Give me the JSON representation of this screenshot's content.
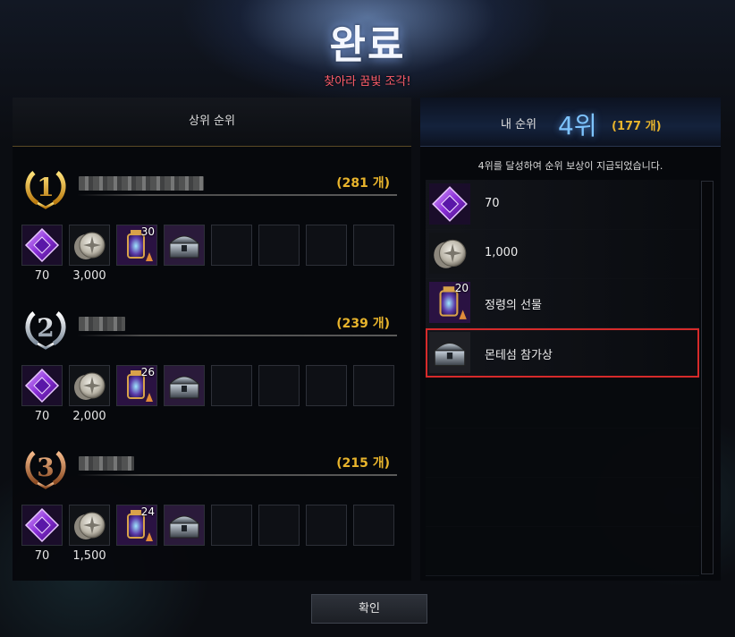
{
  "header": {
    "title": "완료",
    "subtitle": "찾아라 꿈빛 조각!"
  },
  "leaderboard": {
    "title": "상위 순위",
    "ranks": [
      {
        "rank": "1",
        "medal": "gold-laurel-medal",
        "score": "(281 개)",
        "rewards": [
          {
            "icon": "purple-crystal-icon",
            "value": "70",
            "badge": ""
          },
          {
            "icon": "silver-coin-icon",
            "value": "3,000",
            "badge": ""
          },
          {
            "icon": "lantern-gift-icon",
            "value": "",
            "badge": "30"
          },
          {
            "icon": "treasure-chest-icon",
            "value": "",
            "badge": ""
          }
        ]
      },
      {
        "rank": "2",
        "medal": "silver-laurel-medal",
        "score": "(239 개)",
        "rewards": [
          {
            "icon": "purple-crystal-icon",
            "value": "70",
            "badge": ""
          },
          {
            "icon": "silver-coin-icon",
            "value": "2,000",
            "badge": ""
          },
          {
            "icon": "lantern-gift-icon",
            "value": "",
            "badge": "26"
          },
          {
            "icon": "treasure-chest-icon",
            "value": "",
            "badge": ""
          }
        ]
      },
      {
        "rank": "3",
        "medal": "bronze-laurel-medal",
        "score": "(215 개)",
        "rewards": [
          {
            "icon": "purple-crystal-icon",
            "value": "70",
            "badge": ""
          },
          {
            "icon": "silver-coin-icon",
            "value": "1,500",
            "badge": ""
          },
          {
            "icon": "lantern-gift-icon",
            "value": "",
            "badge": "24"
          },
          {
            "icon": "treasure-chest-icon",
            "value": "",
            "badge": ""
          }
        ]
      }
    ]
  },
  "my_rank": {
    "label": "내 순위",
    "value": "4위",
    "count": "(177 개)",
    "notice": "4위를 달성하여 순위 보상이 지급되었습니다.",
    "rewards": [
      {
        "icon": "purple-crystal-icon",
        "label": "70",
        "badge": ""
      },
      {
        "icon": "silver-coin-icon",
        "label": "1,000",
        "badge": ""
      },
      {
        "icon": "lantern-gift-icon",
        "label": "정령의 선물",
        "badge": "20"
      },
      {
        "icon": "treasure-chest-icon",
        "label": "몬테섬 참가상",
        "badge": "",
        "selected": true
      }
    ]
  },
  "footer": {
    "confirm_label": "확인"
  },
  "colors": {
    "gold": "#e8b42c",
    "rank_blue": "#7ec4ff",
    "subtitle_red": "#ff5d6a",
    "selection_red": "#d62a2a"
  }
}
